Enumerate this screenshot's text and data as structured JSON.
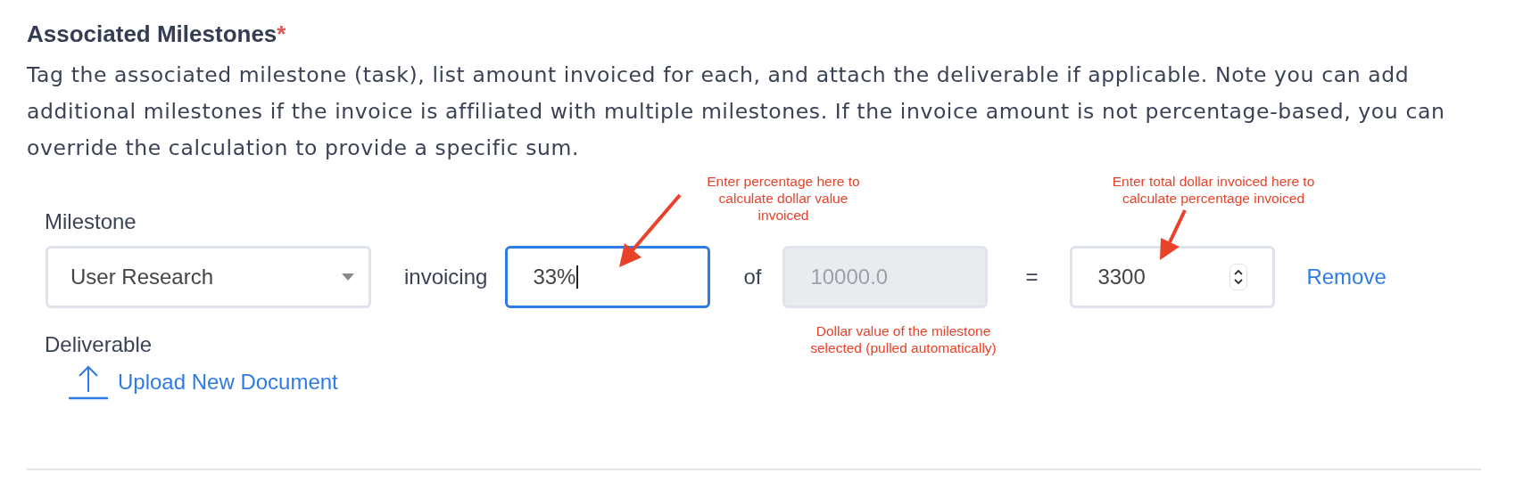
{
  "section": {
    "title": "Associated Milestones",
    "required": true,
    "required_mark": "*",
    "description": "Tag the associated milestone (task), list amount invoiced for each, and attach the deliverable if applicable. Note you can add additional milestones if the invoice is affiliated with multiple milestones. If the invoice amount is not percentage-based, you can override the calculation to provide a specific sum."
  },
  "milestone_row": {
    "label": "Milestone",
    "milestone_select": {
      "value": "User Research"
    },
    "invoicing_label": "invoicing",
    "percent_input": {
      "value": "33%",
      "focused": true
    },
    "of_label": "of",
    "milestone_value": {
      "value": "10000.0",
      "disabled": true
    },
    "equals_label": "=",
    "total_input": {
      "value": "3300"
    },
    "remove_link": "Remove"
  },
  "deliverable": {
    "label": "Deliverable",
    "upload_link": "Upload New Document"
  },
  "annotations": [
    {
      "text": "Enter percentage here to calculate dollar value invoiced"
    },
    {
      "text": "Enter total dollar invoiced here to calculate percentage invoiced"
    },
    {
      "text": "Dollar value of the milestone selected (pulled automatically)"
    }
  ]
}
